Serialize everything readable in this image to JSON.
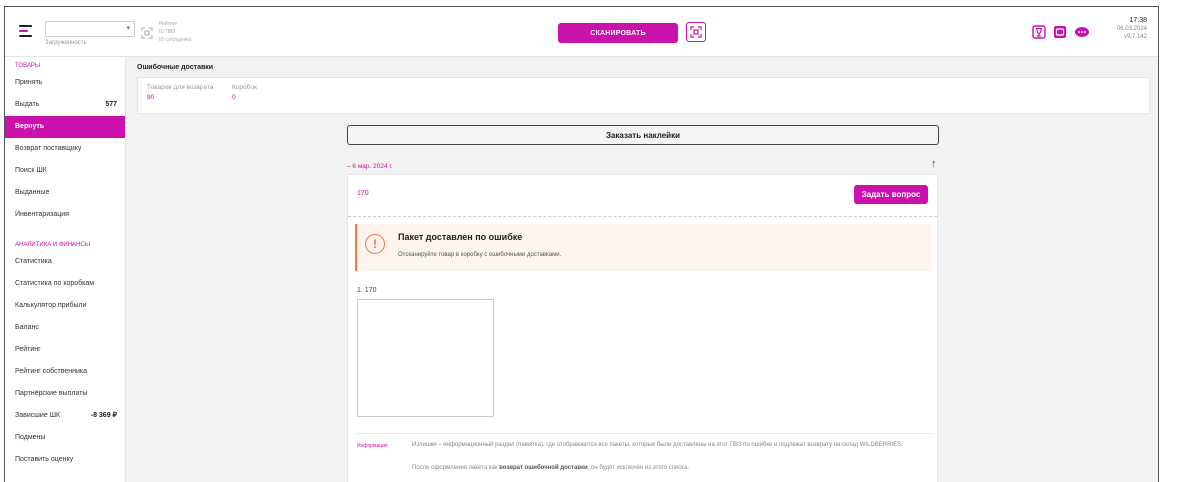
{
  "header": {
    "pvz_caption": "Загруженность",
    "rating": {
      "line1": "Рейтинг",
      "line2": "ID ПВЗ",
      "line3": "ID сотрудника"
    },
    "scan_label": "СКАНИРОВАТЬ",
    "time": "17:38",
    "date": "06.03.2024",
    "version": "v9.7.142"
  },
  "sidebar": {
    "section_goods": "ТОВАРЫ",
    "section_finance": "АНАЛИТИКА И ФИНАНСЫ",
    "items": [
      {
        "label": "Принять"
      },
      {
        "label": "Выдать",
        "badge": "577"
      },
      {
        "label": "Вернуть"
      },
      {
        "label": "Возврат поставщику"
      },
      {
        "label": "Поиск ШК"
      },
      {
        "label": "Выданные"
      },
      {
        "label": "Инвентаризация"
      }
    ],
    "finance_items": [
      {
        "label": "Статистика"
      },
      {
        "label": "Статистика по коробкам"
      },
      {
        "label": "Калькулятор прибыли"
      },
      {
        "label": "Баланс"
      },
      {
        "label": "Рейтинг"
      },
      {
        "label": "Рейтинг собственника"
      },
      {
        "label": "Партнёрские выплаты"
      },
      {
        "label": "Зависшие ШК",
        "badge": "-8 369 ₽"
      },
      {
        "label": "Подмены"
      },
      {
        "label": "Поставить оценку"
      }
    ]
  },
  "main": {
    "title": "Ошибочные доставки",
    "stats": {
      "returns_label": "Товаров для возврата",
      "returns_value": "90",
      "boxes_label": "Коробок",
      "boxes_value": "0"
    },
    "order_stickers_label": "Заказать наклейки",
    "date_label": "– 6 мар. 2024 г.",
    "box": {
      "number": "170",
      "ask_label": "Задать вопрос",
      "alert_title": "Пакет доставлен по ошибке",
      "alert_text": "Отсканируйте товар в коробку с ошибочными доставками.",
      "item_label": "1. 170",
      "info_title": "Информация",
      "info_text": "Излишки – информационный раздел (памятка), где отображаются все пакеты, которые были доставлены на этот ПВЗ по ошибке и подлежат возврату на склад WILDBERRIES.",
      "info_text2_prefix": "После оформления пакета как ",
      "info_text2_bold": "возврат ошибочной доставки",
      "info_text2_suffix": ", он будет исключён из этого списка."
    }
  },
  "colors": {
    "brand": "#cb11ab",
    "alert": "#f07b3c"
  },
  "icons": [
    "menu-icon",
    "chevron-down-icon",
    "rating-scan-icon",
    "qr-scan-icon",
    "wine-glass-icon",
    "wallet-icon",
    "chat-icon",
    "arrow-up-icon",
    "warning-icon"
  ]
}
